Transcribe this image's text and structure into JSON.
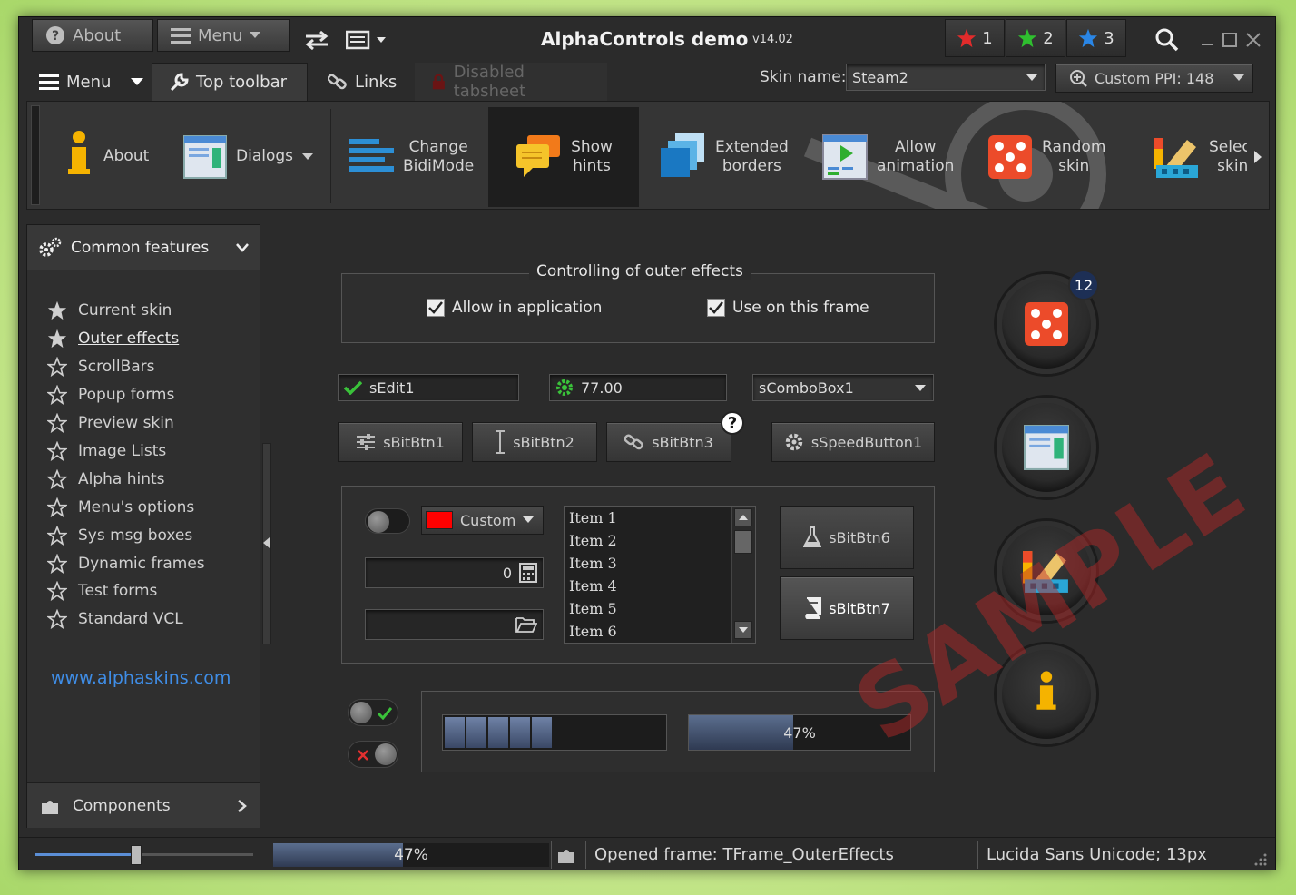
{
  "titlebar": {
    "about_label": "About",
    "menu_label": "Menu",
    "title": "AlphaControls demo",
    "version": "v14.02",
    "stars": [
      "1",
      "2",
      "3"
    ],
    "colors": {
      "star1": "#e22b2b",
      "star2": "#2fbf2f",
      "star3": "#2a86e6"
    }
  },
  "tabs": {
    "menu_label": "Menu",
    "items": [
      "Top toolbar",
      "Links",
      "Disabled tabsheet"
    ],
    "skin_name_label": "Skin name:",
    "skin_name_value": "Steam2",
    "ppi_label": "Custom PPI: 148"
  },
  "toolbar": {
    "items": [
      "About",
      "Dialogs",
      "Change\nBidiMode",
      "Show\nhints",
      "Extended\nborders",
      "Allow\nanimation",
      "Random\nskin",
      "Select\nskin"
    ]
  },
  "sidebar": {
    "header": "Common features",
    "items": [
      "Current skin",
      "Outer effects",
      "ScrollBars",
      "Popup forms",
      "Preview skin",
      "Image Lists",
      "Alpha hints",
      "Menu's options",
      "Sys msg boxes",
      "Dynamic frames",
      "Test forms",
      "Standard VCL"
    ],
    "link": "www.alphaskins.com",
    "footer": "Components"
  },
  "content": {
    "group_title": "Controlling of outer effects",
    "check1": "Allow in application",
    "check2": "Use on this frame",
    "edit1": "sEdit1",
    "spin_value": "77.00",
    "combo1": "sComboBox1",
    "btn1": "sBitBtn1",
    "btn2": "sBitBtn2",
    "btn3": "sBitBtn3",
    "help_mark": "?",
    "speed1": "sSpeedButton1",
    "color_combo": "Custom",
    "calc_value": "0",
    "list_items": [
      "Item 1",
      "Item 2",
      "Item 3",
      "Item 4",
      "Item 5",
      "Item 6"
    ],
    "btn6": "sBitBtn6",
    "btn7": "sBitBtn7",
    "progress2_label": "47%",
    "progress2_value": 0.47,
    "progress1_blocks": 5,
    "badge": "12",
    "watermark": "SAMPLE"
  },
  "statusbar": {
    "progress_label": "47%",
    "progress_value": 0.47,
    "slider_value": 0.47,
    "frame_text": "Opened frame: TFrame_OuterEffects",
    "font_text": "Lucida Sans Unicode; 13px"
  }
}
